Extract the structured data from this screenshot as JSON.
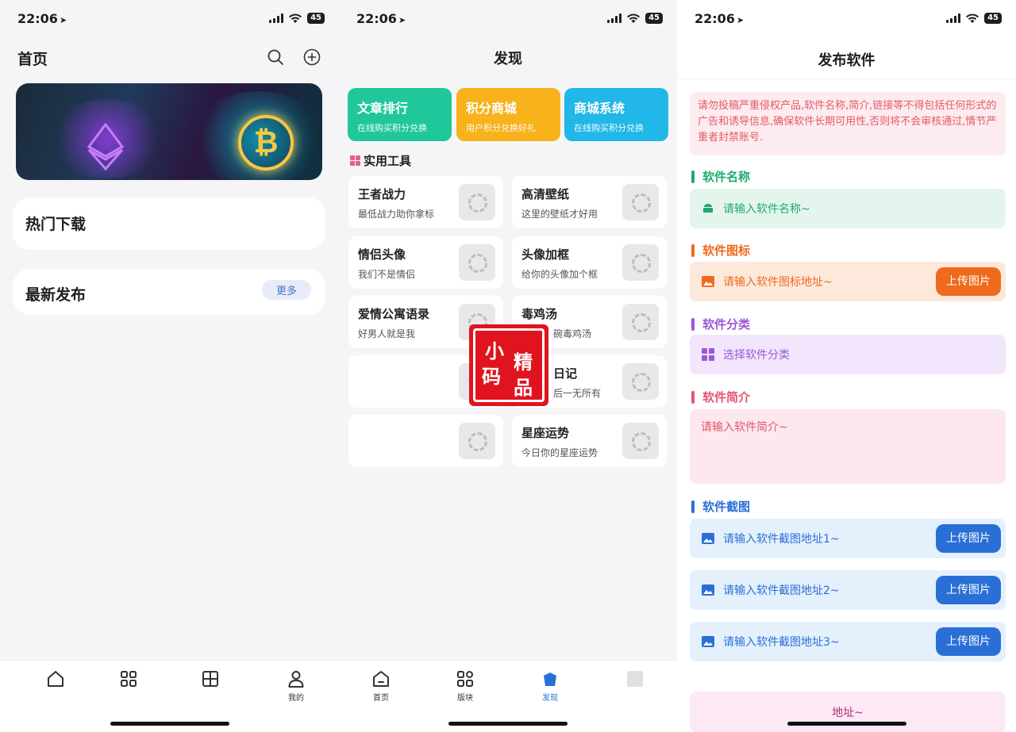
{
  "status": {
    "time": "22:06",
    "battery": "45"
  },
  "panel1": {
    "title": "首页",
    "search_icon": "search-icon",
    "add_icon": "add-circle-icon",
    "hot_title": "热门下载",
    "latest_title": "最新发布",
    "more_label": "更多",
    "tabs": [
      {
        "label": "",
        "icon": "home-icon"
      },
      {
        "label": "",
        "icon": "blocks-icon"
      },
      {
        "label": "",
        "icon": "discover-icon"
      },
      {
        "label": "我的",
        "icon": "user-icon"
      }
    ]
  },
  "panel2": {
    "title": "发现",
    "promos": [
      {
        "title": "文章排行",
        "subtitle": "在线购买积分兑换",
        "color": "#1fc79a"
      },
      {
        "title": "积分商城",
        "subtitle": "用户积分兑换好礼",
        "color": "#f7b21c"
      },
      {
        "title": "商城系统",
        "subtitle": "在线购买积分兑换",
        "color": "#21b7e8"
      }
    ],
    "tools_title": "实用工具",
    "tools": [
      {
        "title": "王者战力",
        "subtitle": "最低战力助你拿标"
      },
      {
        "title": "高清壁纸",
        "subtitle": "这里的壁纸才好用"
      },
      {
        "title": "情侣头像",
        "subtitle": "我们不是情侣"
      },
      {
        "title": "头像加框",
        "subtitle": "给你的头像加个框"
      },
      {
        "title": "爱情公寓语录",
        "subtitle": "好男人就是我"
      },
      {
        "title": "毒鸡汤",
        "subtitle": "碗毒鸡汤"
      },
      {
        "title": "",
        "subtitle": ""
      },
      {
        "title": "日记",
        "subtitle": "后一无所有"
      },
      {
        "title": "",
        "subtitle": ""
      },
      {
        "title": "星座运势",
        "subtitle": "今日你的星座运势"
      }
    ],
    "stamp": {
      "c1": "小",
      "c2": "码",
      "c3": "精",
      "c4": "品"
    },
    "tabs": [
      {
        "label": "首页",
        "icon": "home-icon"
      },
      {
        "label": "版块",
        "icon": "blocks-icon"
      },
      {
        "label": "发现",
        "icon": "discover-icon"
      },
      {
        "label": "",
        "icon": "user-icon"
      }
    ]
  },
  "panel3": {
    "title": "发布软件",
    "warning": "请勿投稿严重侵权产品,软件名称,简介,链接等不得包括任何形式的广告和诱导信息,确保软件长期可用性,否则将不会审核通过,情节严重者封禁账号.",
    "name_label": "软件名称",
    "name_placeholder": "请输入软件名称~",
    "icon_label": "软件图标",
    "icon_placeholder": "请输入软件图标地址~",
    "category_label": "软件分类",
    "category_placeholder": "选择软件分类",
    "intro_label": "软件简介",
    "intro_placeholder": "请输入软件简介~",
    "shots_label": "软件截图",
    "shot_placeholders": [
      "请输入软件截图地址1~",
      "请输入软件截图地址2~",
      "请输入软件截图地址3~"
    ],
    "upload_label": "上传图片",
    "bottom_placeholder": "地址~",
    "colors": {
      "green": "#1faa6e",
      "orange": "#ee6a1d",
      "purple": "#9b59d6",
      "pink": "#e2566e",
      "blue": "#2a6fd6"
    }
  }
}
